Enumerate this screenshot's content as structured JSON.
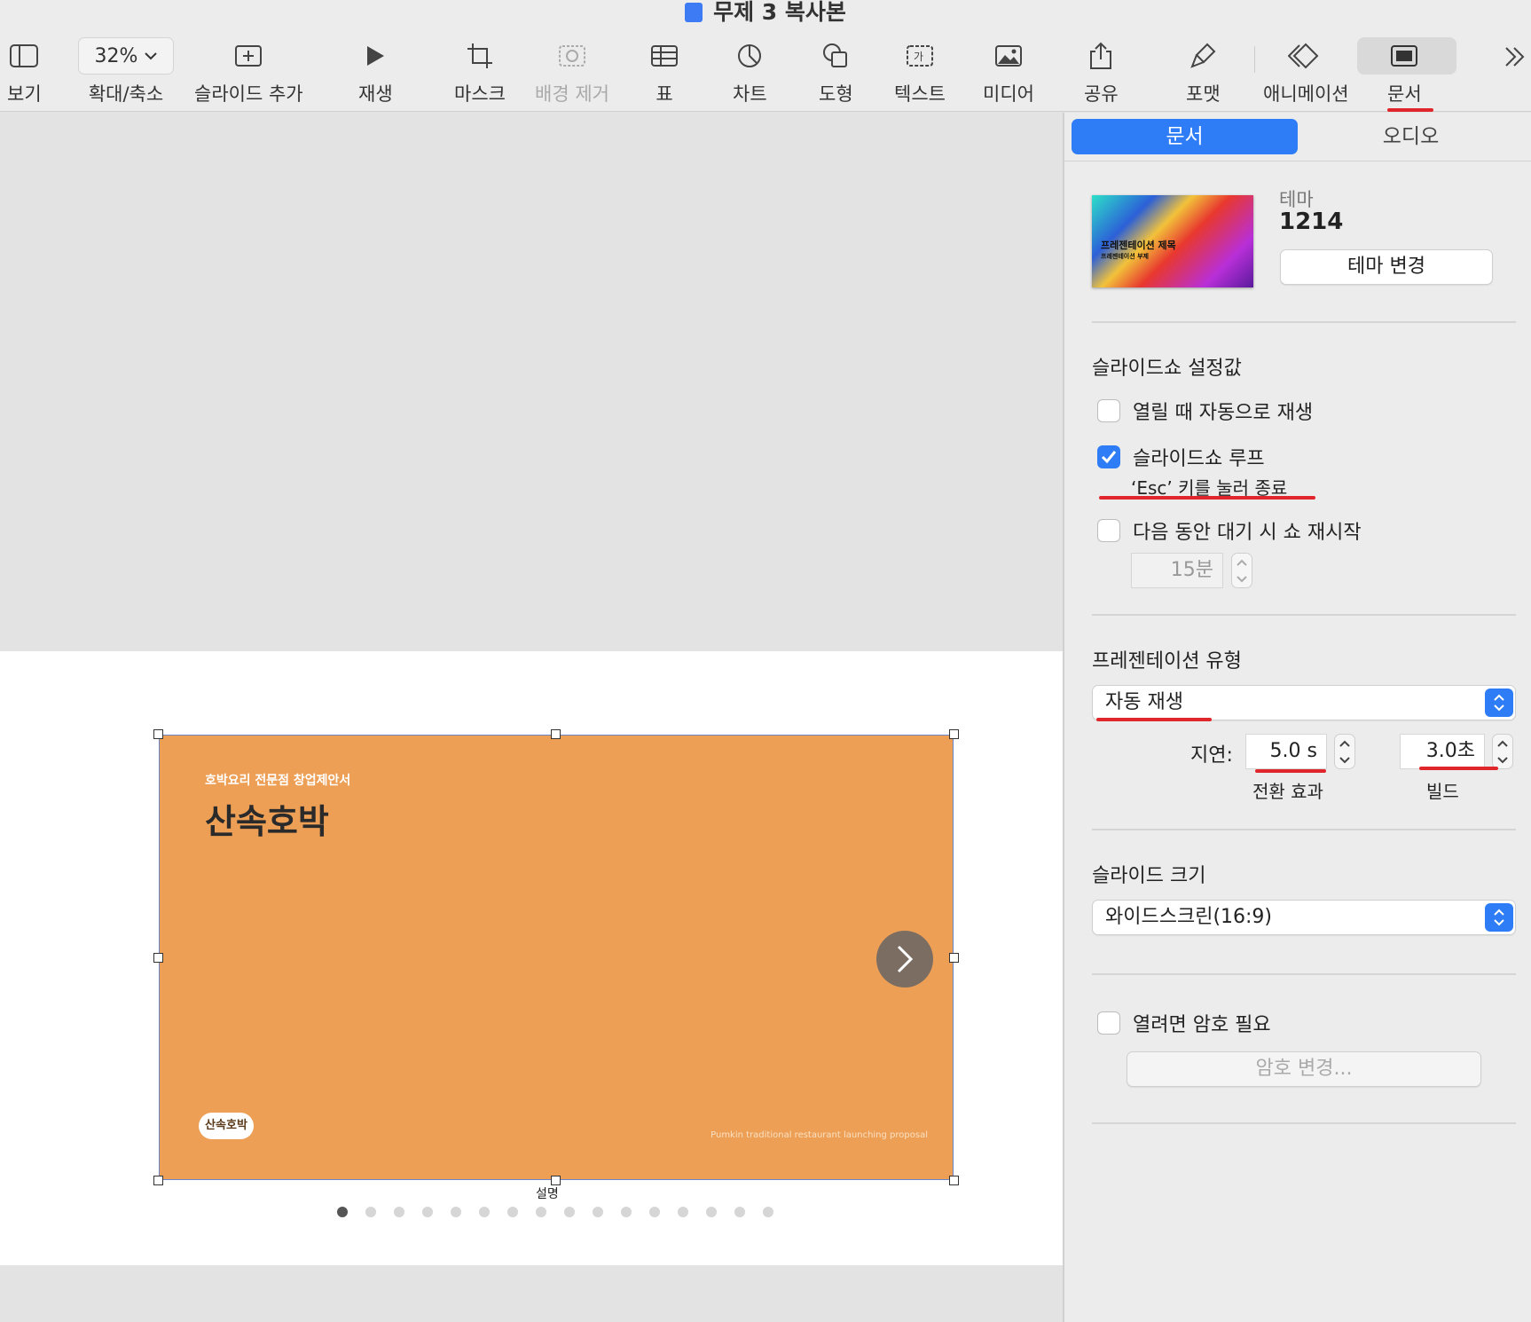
{
  "window": {
    "title": "무제 3 복사본"
  },
  "toolbar": {
    "view": "보기",
    "zoom_value": "32%",
    "zoom": "확대/축소",
    "add_slide": "슬라이드 추가",
    "play": "재생",
    "mask": "마스크",
    "remove_bg": "배경 제거",
    "table": "표",
    "chart": "차트",
    "shape": "도형",
    "text": "텍스트",
    "media": "미디어",
    "share": "공유",
    "format": "포맷",
    "animate": "애니메이션",
    "document": "문서"
  },
  "slide": {
    "subtitle": "호박요리 전문점 창업제안서",
    "title": "산속호박",
    "logo_text": "산속호박",
    "english_text": "Pumkin traditional restaurant launching proposal",
    "caption_label": "설명",
    "dots_count": 16,
    "active_dot": 0
  },
  "inspector": {
    "tabs": [
      "문서",
      "오디오"
    ],
    "active_tab": 0,
    "theme": {
      "label": "테마",
      "name": "1214",
      "thumb_title": "프레젠테이션 제목",
      "thumb_subtitle": "프레젠테이션 부제",
      "change_button": "테마 변경"
    },
    "slideshow": {
      "title": "슬라이드쇼 설정값",
      "autoplay_on_open": {
        "label": "열릴 때 자동으로 재생",
        "checked": false
      },
      "loop": {
        "label": "슬라이드쇼 루프",
        "checked": true
      },
      "esc_hint": "‘Esc’ 키를 눌러 종료",
      "restart_idle": {
        "label": "다음 동안 대기 시 쇼 재시작",
        "checked": false
      },
      "idle_value": "15분"
    },
    "presentation_type": {
      "title": "프레젠테이션 유형",
      "selected": "자동 재생",
      "delay_label": "지연:",
      "transition_value": "5.0 s",
      "build_value": "3.0초",
      "transition_label": "전환 효과",
      "build_label": "빌드"
    },
    "slide_size": {
      "title": "슬라이드 크기",
      "selected": "와이드스크린(16:9)"
    },
    "password": {
      "label": "열려면 암호 필요",
      "checked": false,
      "change_button": "암호 변경..."
    }
  },
  "colors": {
    "accent": "#2f7df6",
    "slide_bg": "#ec9f55",
    "annotation": "#e0262a"
  }
}
